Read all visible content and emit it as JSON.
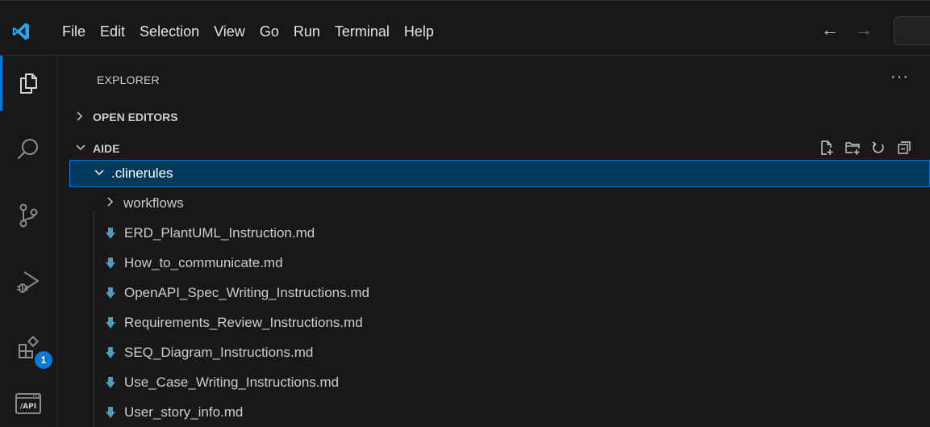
{
  "menu": {
    "items": [
      "File",
      "Edit",
      "Selection",
      "View",
      "Go",
      "Run",
      "Terminal",
      "Help"
    ]
  },
  "nav": {
    "back": "←",
    "forward": "→"
  },
  "activity": {
    "extensions_badge": "1",
    "api_label": "/API"
  },
  "explorer": {
    "title": "EXPLORER",
    "more": "···",
    "open_editors": "OPEN EDITORS",
    "workspace": "AIDE",
    "folder": ".clinerules",
    "subfolder": "workflows",
    "files": [
      "ERD_PlantUML_Instruction.md",
      "How_to_communicate.md",
      "OpenAPI_Spec_Writing_Instructions.md",
      "Requirements_Review_Instructions.md",
      "SEQ_Diagram_Instructions.md",
      "Use_Case_Writing_Instructions.md",
      "User_story_info.md"
    ]
  },
  "colors": {
    "accent": "#0078d4",
    "selection": "#04395e",
    "file_icon": "#519aba",
    "logo": "#23a9f2"
  }
}
